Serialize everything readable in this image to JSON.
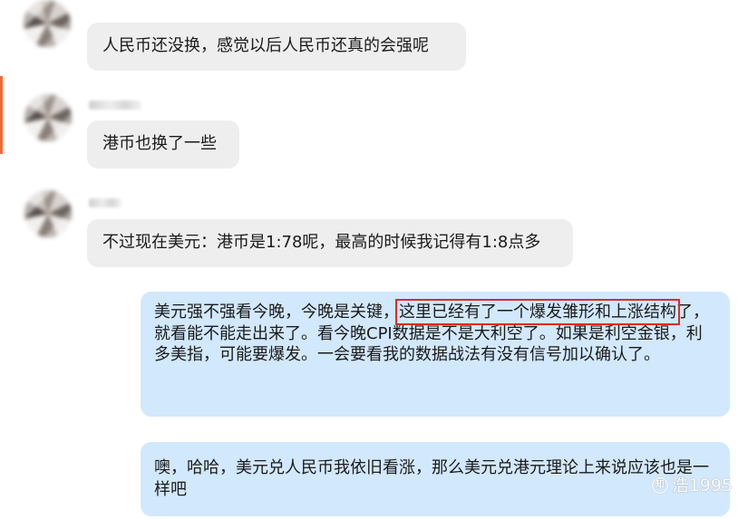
{
  "messages": [
    {
      "direction": "incoming",
      "text": "人民币还没换，感觉以后人民币还真的会强呢"
    },
    {
      "direction": "incoming",
      "text": "港币也换了一些"
    },
    {
      "direction": "incoming",
      "text": "不过现在美元：港币是1:78呢，最高的时候我记得有1:8点多"
    },
    {
      "direction": "outgoing",
      "text_before": "美元强不强看今晚，今晚是关键，",
      "highlighted": "这里已经有了一个爆发雏形和上涨结构",
      "text_after": "了，就看能不能走出来了。看今晚CPI数据是不是大利空了。如果是利空金银，利多美指，可能要爆发。一会要看我的数据战法有没有信号加以确认了。"
    },
    {
      "direction": "outgoing",
      "text": "噢，哈哈，美元兑人民币我依旧看涨，那么美元兑港元理论上来说应该也是一样吧"
    }
  ],
  "watermark": {
    "logo": "知",
    "text": "浩1995"
  },
  "colors": {
    "incoming_bubble": "#eeeeee",
    "outgoing_bubble": "#d2e8fc",
    "highlight_box": "#e0282e",
    "accent": "#f06a3c"
  }
}
